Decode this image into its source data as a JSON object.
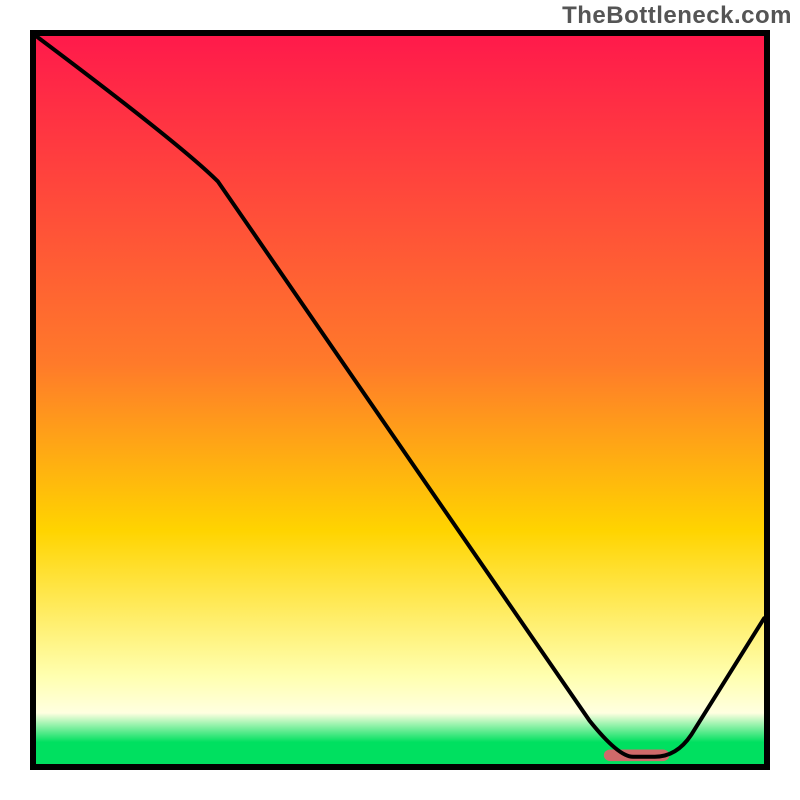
{
  "watermark": "TheBottleneck.com",
  "colors": {
    "border": "#000000",
    "line": "#000000",
    "marker": "#cf6a6a",
    "grad_top": "#ff1a4b",
    "grad_upper": "#ff7a2a",
    "grad_mid": "#ffd400",
    "grad_lower": "#ffffb0",
    "grad_green": "#00e060"
  },
  "chart_data": {
    "type": "line",
    "title": "",
    "xlabel": "",
    "ylabel": "",
    "xlim": [
      0,
      100
    ],
    "ylim": [
      0,
      100
    ],
    "grad_stops_pct": [
      0,
      45,
      68,
      88,
      93,
      97,
      100
    ],
    "series": [
      {
        "name": "curve",
        "x": [
          0,
          25,
          80,
          85,
          100
        ],
        "y": [
          100,
          80,
          1,
          1,
          20
        ]
      }
    ],
    "marker": {
      "x_start": 78,
      "x_end": 87,
      "y": 1.2,
      "thickness_pct": 1.6
    }
  }
}
